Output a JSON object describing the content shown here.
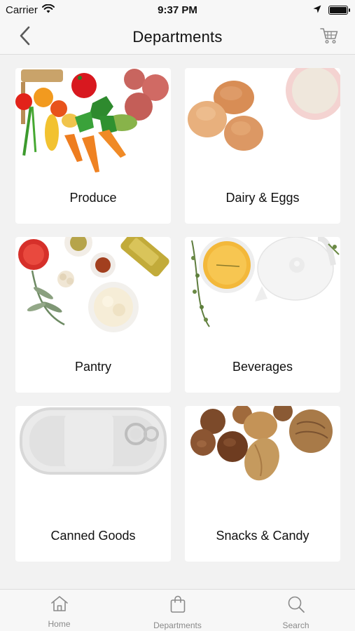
{
  "status_bar": {
    "carrier": "Carrier",
    "time": "9:37 PM",
    "battery_level": 1.0
  },
  "nav": {
    "title": "Departments",
    "back_icon": "chevron-left-icon",
    "cart_icon": "cart-icon"
  },
  "departments": [
    {
      "label": "Produce",
      "image": "produce-image"
    },
    {
      "label": "Dairy & Eggs",
      "image": "dairy-eggs-image"
    },
    {
      "label": "Pantry",
      "image": "pantry-image"
    },
    {
      "label": "Beverages",
      "image": "beverages-image"
    },
    {
      "label": "Canned Goods",
      "image": "canned-goods-image"
    },
    {
      "label": "Snacks & Candy",
      "image": "snacks-candy-image"
    }
  ],
  "tabs": [
    {
      "label": "Home",
      "icon": "home-icon"
    },
    {
      "label": "Departments",
      "icon": "shopping-bag-icon"
    },
    {
      "label": "Search",
      "icon": "search-icon"
    }
  ],
  "colors": {
    "background": "#f2f2f2",
    "bar_background": "#f7f7f7",
    "card": "#ffffff",
    "tab_inactive": "#8a8a8a"
  }
}
